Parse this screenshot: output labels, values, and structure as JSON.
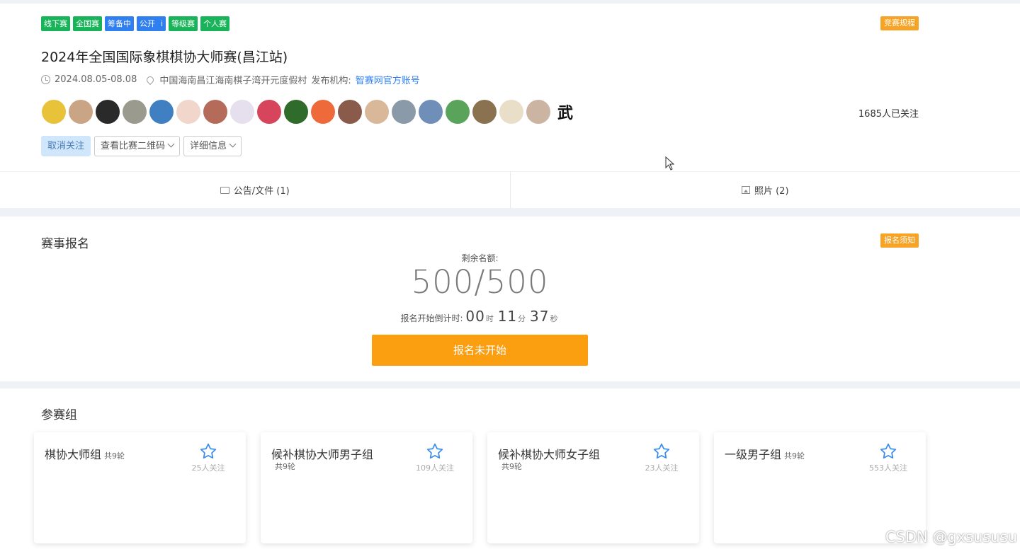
{
  "header": {
    "tags": [
      {
        "label": "线下赛",
        "color": "green"
      },
      {
        "label": "全国赛",
        "color": "green"
      },
      {
        "label": "筹备中",
        "color": "blue"
      },
      {
        "label": "公开",
        "color": "blue",
        "info": "i"
      },
      {
        "label": "等级赛",
        "color": "green"
      },
      {
        "label": "个人赛",
        "color": "green"
      }
    ],
    "rules_label": "竞赛规程",
    "title": "2024年全国国际象棋棋协大师赛(昌江站)",
    "date": "2024.08.05-08.08",
    "location": "中国海南昌江海南棋子湾开元度假村",
    "publisher_label": "发布机构:",
    "publisher": "智赛网官方账号",
    "followers": "1685人已关注",
    "avatar_colors": [
      "#e8c33a",
      "#c9a585",
      "#2a2a2a",
      "#9a9a8e",
      "#3f7fc2",
      "#f1d6cc",
      "#b56b5a",
      "#e6e0ee",
      "#d6455c",
      "#2f6b2a",
      "#ee6a3a",
      "#8a5a4a",
      "#d9b89a",
      "#8a9aa8",
      "#6f8fb8",
      "#5aa35a",
      "#8a7250",
      "#e9dfc8",
      "#cbb4a2",
      "#ffffff"
    ],
    "last_avatar_text": "武",
    "buttons": {
      "unfollow": "取消关注",
      "qr": "查看比赛二维码",
      "details": "详细信息"
    }
  },
  "tabs": [
    {
      "label": "公告/文件 (1)"
    },
    {
      "label": "照片 (2)"
    }
  ],
  "registration": {
    "title": "赛事报名",
    "notice_label": "报名须知",
    "remaining_label": "剩余名额:",
    "quota": "500/500",
    "countdown_label": "报名开始倒计时:",
    "hours": "00",
    "hours_unit": "时",
    "minutes": "11",
    "minutes_unit": "分",
    "seconds": "37",
    "seconds_unit": "秒",
    "button": "报名未开始"
  },
  "groups": {
    "title": "参赛组",
    "items": [
      {
        "name": "棋协大师组",
        "rounds": "共9轮",
        "followers": "25人关注"
      },
      {
        "name": "候补棋协大师男子组",
        "rounds": "共9轮",
        "followers": "109人关注"
      },
      {
        "name": "候补棋协大师女子组",
        "rounds": "共9轮",
        "followers": "23人关注"
      },
      {
        "name": "一级男子组",
        "rounds": "共9轮",
        "followers": "553人关注"
      }
    ]
  },
  "watermark": "CSDN @gxsususu"
}
